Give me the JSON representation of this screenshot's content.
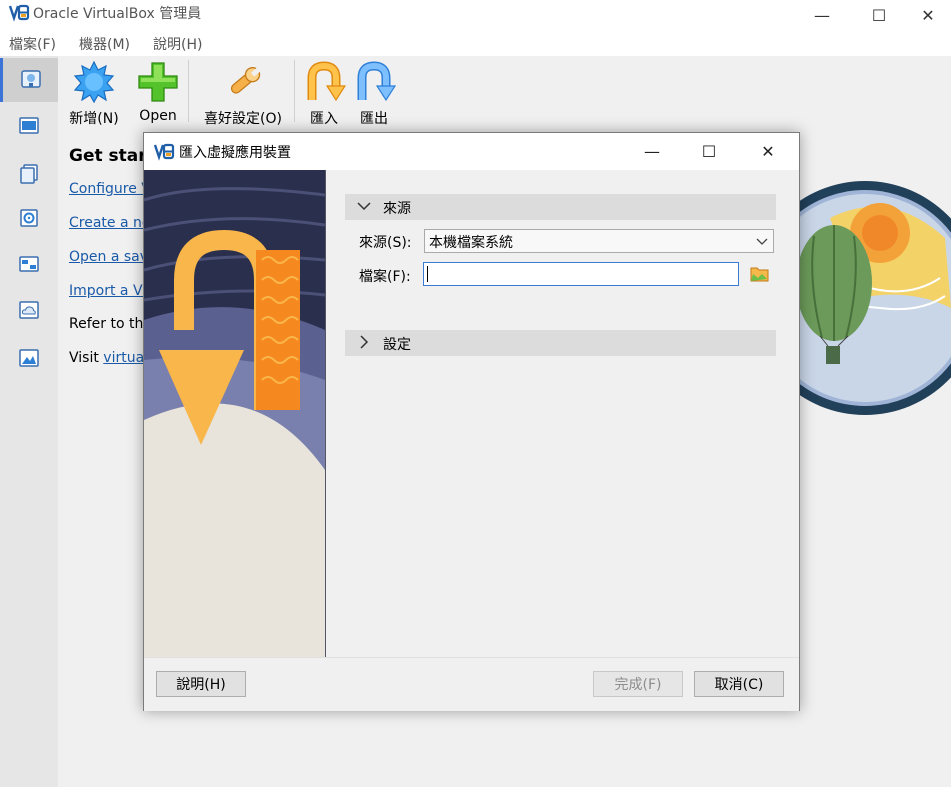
{
  "app": {
    "title": "Oracle VirtualBox 管理員"
  },
  "window_controls": {
    "minimize": "—",
    "maximize": "☐",
    "close": "✕"
  },
  "menu": [
    {
      "label": "檔案(F)"
    },
    {
      "label": "機器(M)"
    },
    {
      "label": "說明(H)"
    }
  ],
  "sidebar": {
    "items": [
      "welcome-icon",
      "machines-icon",
      "extensions-icon",
      "media-icon",
      "network-icon",
      "cloud-icon",
      "activities-icon"
    ]
  },
  "toolbar": {
    "new_label": "新增(N)",
    "open_label": "Open",
    "preferences_label": "喜好設定(O)",
    "import_label": "匯入",
    "export_label": "匯出"
  },
  "welcome": {
    "heading": "Get start",
    "links": [
      "Configure V",
      "Create a ne",
      "Open a sav",
      "Import a VI"
    ],
    "refer_text": "Refer to the",
    "visit_text": "Visit ",
    "visit_link": "virtual"
  },
  "dialog": {
    "title": "匯入虛擬應用裝置",
    "source_section": "來源",
    "source_label": "來源(S):",
    "source_value": "本機檔案系統",
    "file_label": "檔案(F):",
    "file_value": "",
    "settings_section": "設定",
    "help_button": "說明(H)",
    "finish_button": "完成(F)",
    "cancel_button": "取消(C)"
  }
}
